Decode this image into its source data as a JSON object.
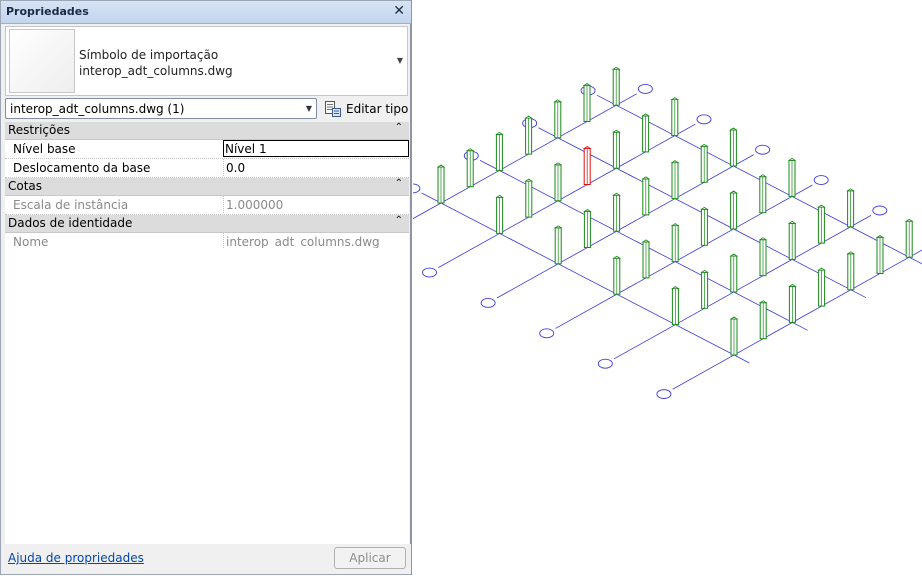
{
  "panel": {
    "title": "Propriedades",
    "close_glyph": "✕",
    "type_category": "Símbolo de importação",
    "type_name": "interop_adt_columns.dwg",
    "type_selector": "interop_adt_columns.dwg (1)",
    "edit_type_label": "Editar tipo",
    "sections": {
      "restricoes": "Restrições",
      "cotas": "Cotas",
      "identidade": "Dados de identidade"
    },
    "rows": {
      "nivel_base": {
        "label": "Nível base",
        "value": "Nível 1"
      },
      "deslocamento": {
        "label": "Deslocamento da base",
        "value": "0.0"
      },
      "escala": {
        "label": "Escala de instância",
        "value": "1.000000"
      },
      "nome": {
        "label": "Nome",
        "value": "interop_adt_columns.dwg"
      }
    },
    "help_link": "Ajuda de propriedades",
    "apply_button": "Aplicar"
  },
  "viewport": {
    "grid_line_color": "#3a3ae0",
    "column_color": "#1a8a1a",
    "selected_column_color": "#e01010",
    "bubble_color": "#3a3ae0"
  }
}
